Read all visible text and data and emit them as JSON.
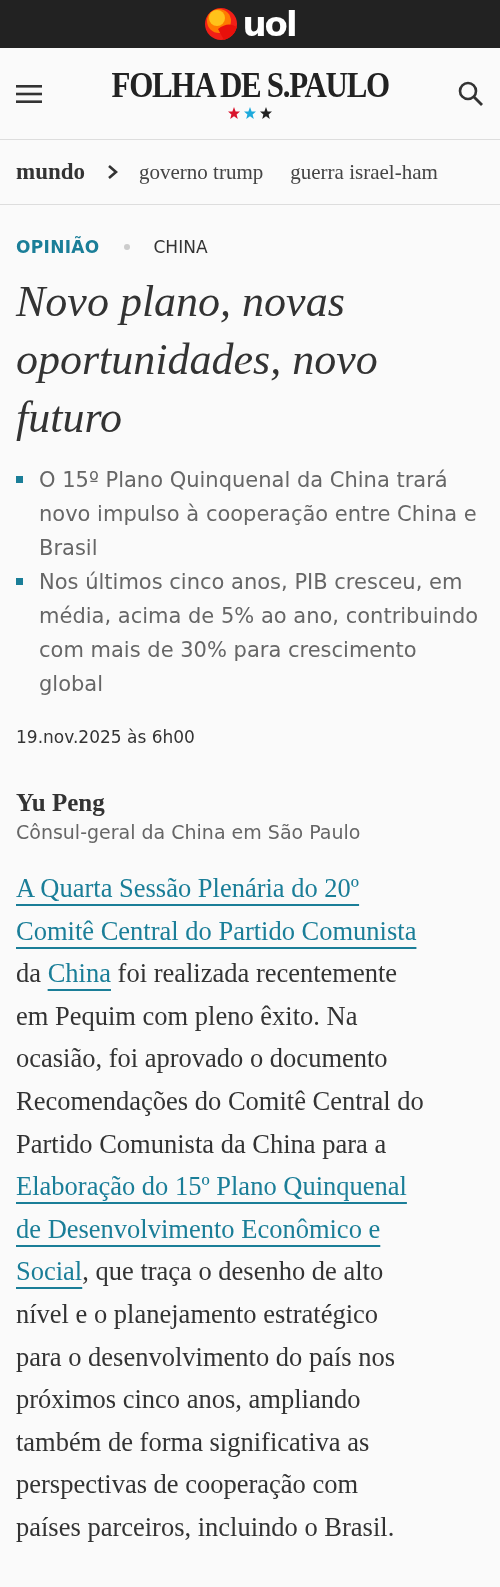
{
  "topbar": {
    "logo_text": "uol"
  },
  "masthead": {
    "title": "FOLHA DE S.PAULO"
  },
  "breadcrumb": {
    "section": "mundo",
    "topics": [
      "governo trump",
      "guerra israel-ham"
    ]
  },
  "article": {
    "kicker": "OPINIÃO",
    "tag": "CHINA",
    "headline": "Novo plano, novas oportunidades, novo futuro",
    "highlights": [
      "O 15º Plano Quinquenal da China trará novo impulso à cooperação entre China e Brasil",
      "Nos últimos cinco anos, PIB cresceu, em média, acima de 5% ao ano, contribuindo com mais de 30% para crescimento global"
    ],
    "date": "19.nov.2025 às 6h00",
    "author": {
      "name": "Yu Peng",
      "role": "Cônsul-geral da China em São Paulo"
    },
    "body_lines": [
      [
        {
          "kind": "link",
          "text": "A Quarta Sessão Plenária do 20º"
        }
      ],
      [
        {
          "kind": "link",
          "text": "Comitê Central do Partido Comunista"
        }
      ],
      [
        {
          "kind": "text",
          "text": "da "
        },
        {
          "kind": "link",
          "text": "China"
        },
        {
          "kind": "text",
          "text": " foi realizada recentemente"
        }
      ],
      [
        {
          "kind": "text",
          "text": "em Pequim com pleno êxito. Na"
        }
      ],
      [
        {
          "kind": "text",
          "text": "ocasião, foi aprovado o documento"
        }
      ],
      [
        {
          "kind": "text",
          "text": "Recomendações do Comitê Central do"
        }
      ],
      [
        {
          "kind": "text",
          "text": "Partido Comunista da China para a"
        }
      ],
      [
        {
          "kind": "link",
          "text": "Elaboração do 15º Plano Quinquenal"
        }
      ],
      [
        {
          "kind": "link",
          "text": "de Desenvolvimento Econômico e"
        }
      ],
      [
        {
          "kind": "link",
          "text": "Social"
        },
        {
          "kind": "text",
          "text": ", que traça o desenho de alto"
        }
      ],
      [
        {
          "kind": "text",
          "text": "nível e o planejamento estratégico"
        }
      ],
      [
        {
          "kind": "text",
          "text": "para o desenvolvimento do país nos"
        }
      ],
      [
        {
          "kind": "text",
          "text": "próximos cinco anos, ampliando"
        }
      ],
      [
        {
          "kind": "text",
          "text": "também de forma significativa as"
        }
      ],
      [
        {
          "kind": "text",
          "text": "perspectivas de cooperação com"
        }
      ],
      [
        {
          "kind": "text",
          "text": "países parceiros, incluindo o Brasil."
        }
      ]
    ]
  }
}
